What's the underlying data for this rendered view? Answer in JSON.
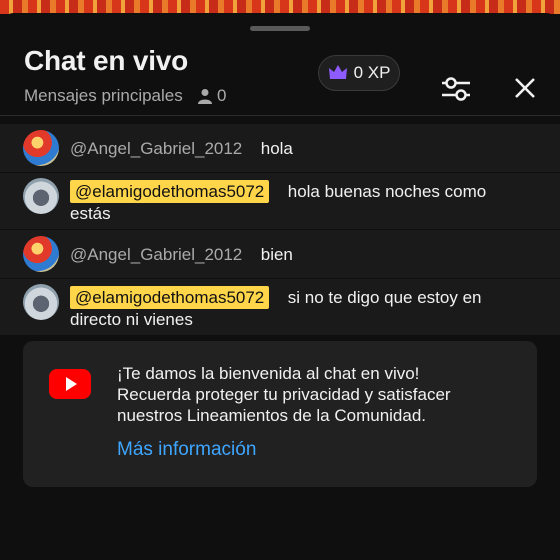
{
  "header": {
    "title": "Chat en vivo",
    "subtitle": "Mensajes principales",
    "viewer_count": "0",
    "xp_label": "0 XP"
  },
  "messages": [
    {
      "author": "@Angel_Gabriel_2012",
      "text": "hola",
      "avatar": "mario-avatar",
      "highlighted": false
    },
    {
      "author": "@elamigodethomas5072",
      "text_line1": "hola buenas noches como",
      "text_line2": "estás",
      "avatar": "thomas-avatar",
      "highlighted": true
    },
    {
      "author": "@Angel_Gabriel_2012",
      "text": "bien",
      "avatar": "mario-avatar",
      "highlighted": false
    },
    {
      "author": "@elamigodethomas5072",
      "text_line1": "si no te digo que estoy en",
      "text_line2": "directo ni vienes",
      "avatar": "thomas-avatar",
      "highlighted": true
    }
  ],
  "welcome": {
    "line1": "¡Te damos la bienvenida al chat en vivo!",
    "line2": "Recuerda proteger tu privacidad y satisfacer",
    "line3": "nuestros Lineamientos de la Comunidad.",
    "link": "Más información"
  },
  "colors": {
    "background": "#0f0f0f",
    "message_row": "#1a1a1a",
    "highlight_badge": "#ffd54a",
    "link": "#3ea6ff",
    "youtube_red": "#ff0000",
    "crown_purple": "#8e5bff"
  },
  "icons": [
    "crown-icon",
    "person-icon",
    "filter-sliders-icon",
    "close-icon",
    "youtube-logo-icon"
  ]
}
